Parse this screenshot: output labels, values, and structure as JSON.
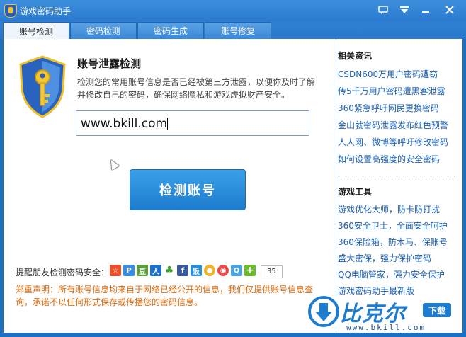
{
  "titlebar": {
    "title": "游戏密码助手"
  },
  "tabs": [
    {
      "label": "账号检测",
      "active": true
    },
    {
      "label": "密码检测",
      "active": false
    },
    {
      "label": "密码生成",
      "active": false
    },
    {
      "label": "账号修复",
      "active": false
    }
  ],
  "main": {
    "heading": "账号泄露检测",
    "description": "检测您的常用账号信息是否已经被第三方泄露，以便你及时了解并修改自己的密码，确保网络隐私和游戏虚拟财产安全。",
    "input_value": "www.bkill.com",
    "check_button": "检测账号",
    "share_label": "提醒朋友检测密码安全：",
    "share_count": "35",
    "disclaimer": "郑重声明：所有账号信息均来自于网络已经公开的信息，我们仅提供账号信息查询，承诺不以任何形式保存或传播您的密码信息。"
  },
  "sidebar": {
    "news_title": "相关资讯",
    "news": [
      "CSDN600万用户密码遭窃",
      "传5千万用户密码遭黑客泄露",
      "360紧急呼吁网民更换密码",
      "金山就密码泄露发布红色预警",
      "人人网、微博等呼吁修改密码",
      "如何设置高强度的安全密码"
    ],
    "tools_title": "游戏工具",
    "tools": [
      "游戏优化大师，防卡防打扰",
      "360安全卫士，全面安全呵护",
      "360保险箱，防木马、保账号",
      "盛大密保，强力保护密码",
      "QQ电脑管家，强力安全保护",
      "游戏密码助手最新版"
    ]
  },
  "watermark": {
    "brand": "比克尔",
    "download": "下载",
    "url": "www.bkill.com"
  },
  "colors": {
    "accent": "#1d7ccf",
    "link": "#1a5fb4",
    "warning": "#e06a0c"
  }
}
